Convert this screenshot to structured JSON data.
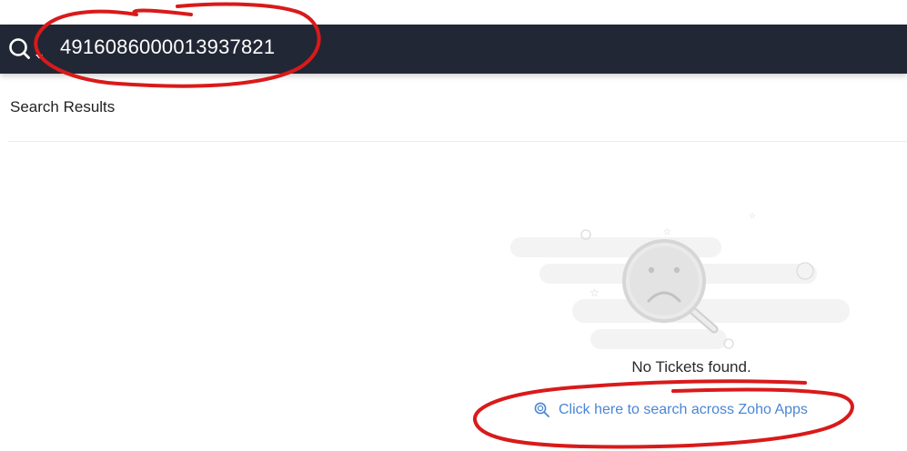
{
  "search": {
    "value": "49160860000​13937821",
    "icon": "search-icon",
    "dropdown_icon": "caret-down-icon"
  },
  "results": {
    "title": "Search Results",
    "empty_message": "No Tickets found.",
    "link_label": "Click here to search across Zoho Apps",
    "link_icon": "zoho-search-icon"
  },
  "colors": {
    "header_bg": "#222735",
    "link": "#4a86d4",
    "annotation": "#d91a1a"
  }
}
